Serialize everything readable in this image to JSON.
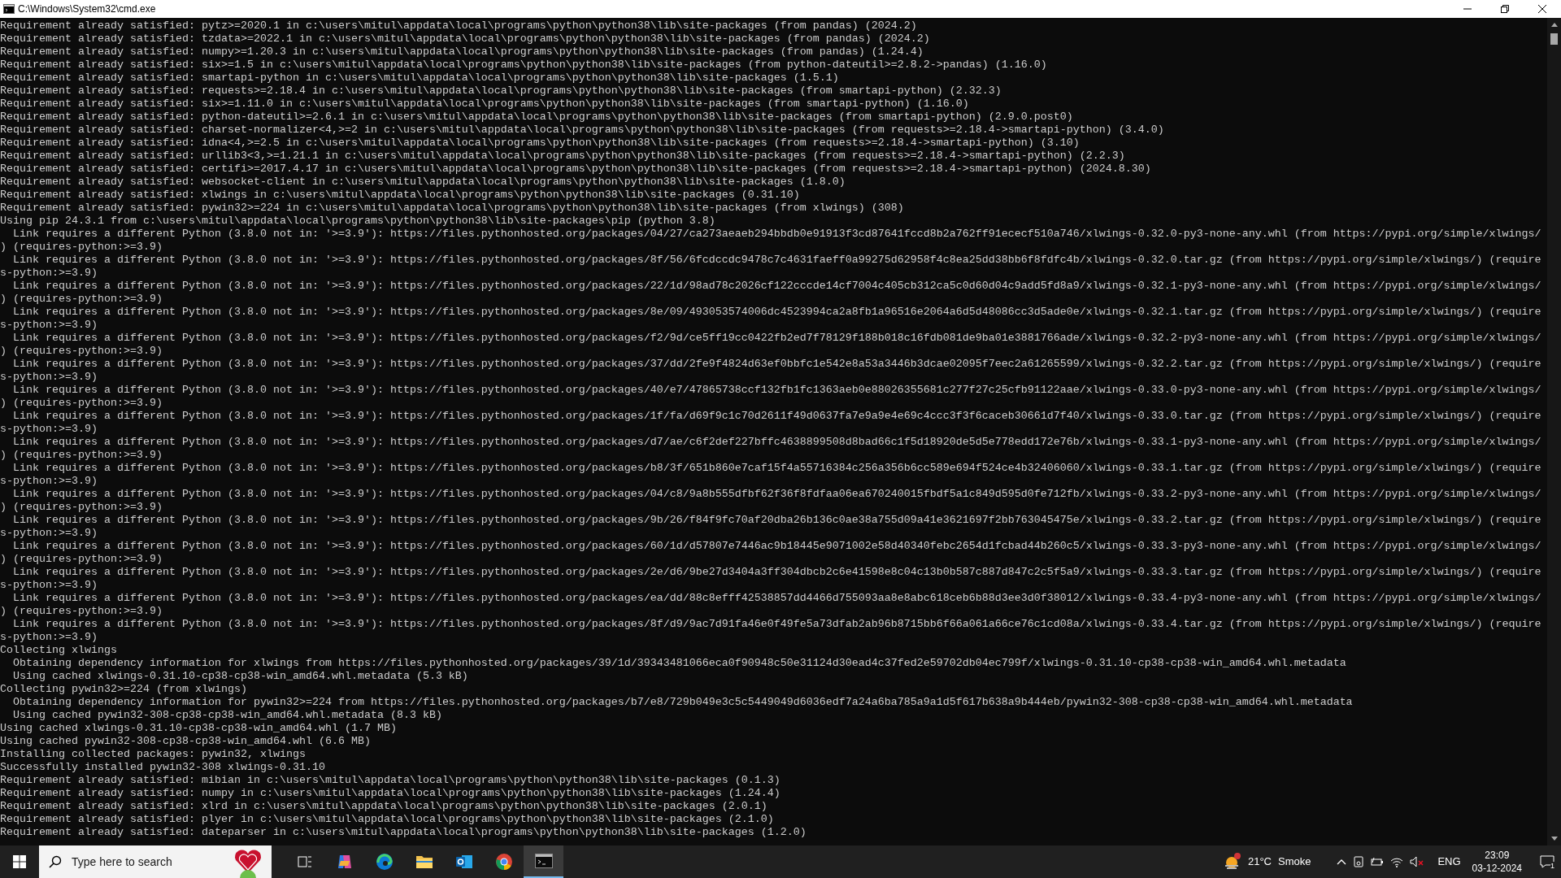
{
  "window": {
    "title": "C:\\Windows\\System32\\cmd.exe"
  },
  "console": {
    "lines": [
      "Requirement already satisfied: pytz>=2020.1 in c:\\users\\mitul\\appdata\\local\\programs\\python\\python38\\lib\\site-packages (from pandas) (2024.2)",
      "Requirement already satisfied: tzdata>=2022.1 in c:\\users\\mitul\\appdata\\local\\programs\\python\\python38\\lib\\site-packages (from pandas) (2024.2)",
      "Requirement already satisfied: numpy>=1.20.3 in c:\\users\\mitul\\appdata\\local\\programs\\python\\python38\\lib\\site-packages (from pandas) (1.24.4)",
      "Requirement already satisfied: six>=1.5 in c:\\users\\mitul\\appdata\\local\\programs\\python\\python38\\lib\\site-packages (from python-dateutil>=2.8.2->pandas) (1.16.0)",
      "Requirement already satisfied: smartapi-python in c:\\users\\mitul\\appdata\\local\\programs\\python\\python38\\lib\\site-packages (1.5.1)",
      "Requirement already satisfied: requests>=2.18.4 in c:\\users\\mitul\\appdata\\local\\programs\\python\\python38\\lib\\site-packages (from smartapi-python) (2.32.3)",
      "Requirement already satisfied: six>=1.11.0 in c:\\users\\mitul\\appdata\\local\\programs\\python\\python38\\lib\\site-packages (from smartapi-python) (1.16.0)",
      "Requirement already satisfied: python-dateutil>=2.6.1 in c:\\users\\mitul\\appdata\\local\\programs\\python\\python38\\lib\\site-packages (from smartapi-python) (2.9.0.post0)",
      "Requirement already satisfied: charset-normalizer<4,>=2 in c:\\users\\mitul\\appdata\\local\\programs\\python\\python38\\lib\\site-packages (from requests>=2.18.4->smartapi-python) (3.4.0)",
      "Requirement already satisfied: idna<4,>=2.5 in c:\\users\\mitul\\appdata\\local\\programs\\python\\python38\\lib\\site-packages (from requests>=2.18.4->smartapi-python) (3.10)",
      "Requirement already satisfied: urllib3<3,>=1.21.1 in c:\\users\\mitul\\appdata\\local\\programs\\python\\python38\\lib\\site-packages (from requests>=2.18.4->smartapi-python) (2.2.3)",
      "Requirement already satisfied: certifi>=2017.4.17 in c:\\users\\mitul\\appdata\\local\\programs\\python\\python38\\lib\\site-packages (from requests>=2.18.4->smartapi-python) (2024.8.30)",
      "Requirement already satisfied: websocket-client in c:\\users\\mitul\\appdata\\local\\programs\\python\\python38\\lib\\site-packages (1.8.0)",
      "Requirement already satisfied: xlwings in c:\\users\\mitul\\appdata\\local\\programs\\python\\python38\\lib\\site-packages (0.31.10)",
      "Requirement already satisfied: pywin32>=224 in c:\\users\\mitul\\appdata\\local\\programs\\python\\python38\\lib\\site-packages (from xlwings) (308)",
      "Using pip 24.3.1 from c:\\users\\mitul\\appdata\\local\\programs\\python\\python38\\lib\\site-packages\\pip (python 3.8)",
      "  Link requires a different Python (3.8.0 not in: '>=3.9'): https://files.pythonhosted.org/packages/04/27/ca273aeaeb294bbdb0e91913f3cd87641fccd8b2a762ff91ececf510a746/xlwings-0.32.0-py3-none-any.whl (from https://pypi.org/simple/xlwings/",
      ") (requires-python:>=3.9)",
      "  Link requires a different Python (3.8.0 not in: '>=3.9'): https://files.pythonhosted.org/packages/8f/56/6fcdccdc9478c7c4631faeff0a99275d62958f4c8ea25dd38bb6f8fdfc4b/xlwings-0.32.0.tar.gz (from https://pypi.org/simple/xlwings/) (require",
      "s-python:>=3.9)",
      "  Link requires a different Python (3.8.0 not in: '>=3.9'): https://files.pythonhosted.org/packages/22/1d/98ad78c2026cf122cccde14cf7004c405cb312ca5c0d60d04c9add5fd8a9/xlwings-0.32.1-py3-none-any.whl (from https://pypi.org/simple/xlwings/",
      ") (requires-python:>=3.9)",
      "  Link requires a different Python (3.8.0 not in: '>=3.9'): https://files.pythonhosted.org/packages/8e/09/493053574006dc4523994ca2a8fb1a96516e2064a6d5d48086cc3d5ade0e/xlwings-0.32.1.tar.gz (from https://pypi.org/simple/xlwings/) (require",
      "s-python:>=3.9)",
      "  Link requires a different Python (3.8.0 not in: '>=3.9'): https://files.pythonhosted.org/packages/f2/9d/ce5ff19cc0422fb2ed7f78129f188b018c16fdb081de9ba01e3881766ade/xlwings-0.32.2-py3-none-any.whl (from https://pypi.org/simple/xlwings/",
      ") (requires-python:>=3.9)",
      "  Link requires a different Python (3.8.0 not in: '>=3.9'): https://files.pythonhosted.org/packages/37/dd/2fe9f4824d63ef0bbfc1e542e8a53a3446b3dcae02095f7eec2a61265599/xlwings-0.32.2.tar.gz (from https://pypi.org/simple/xlwings/) (require",
      "s-python:>=3.9)",
      "  Link requires a different Python (3.8.0 not in: '>=3.9'): https://files.pythonhosted.org/packages/40/e7/47865738ccf132fb1fc1363aeb0e88026355681c277f27c25cfb91122aae/xlwings-0.33.0-py3-none-any.whl (from https://pypi.org/simple/xlwings/",
      ") (requires-python:>=3.9)",
      "  Link requires a different Python (3.8.0 not in: '>=3.9'): https://files.pythonhosted.org/packages/1f/fa/d69f9c1c70d2611f49d0637fa7e9a9e4e69c4ccc3f3f6caceb30661d7f40/xlwings-0.33.0.tar.gz (from https://pypi.org/simple/xlwings/) (require",
      "s-python:>=3.9)",
      "  Link requires a different Python (3.8.0 not in: '>=3.9'): https://files.pythonhosted.org/packages/d7/ae/c6f2def227bffc4638899508d8bad66c1f5d18920de5d5e778edd172e76b/xlwings-0.33.1-py3-none-any.whl (from https://pypi.org/simple/xlwings/",
      ") (requires-python:>=3.9)",
      "  Link requires a different Python (3.8.0 not in: '>=3.9'): https://files.pythonhosted.org/packages/b8/3f/651b860e7caf15f4a55716384c256a356b6cc589e694f524ce4b32406060/xlwings-0.33.1.tar.gz (from https://pypi.org/simple/xlwings/) (require",
      "s-python:>=3.9)",
      "  Link requires a different Python (3.8.0 not in: '>=3.9'): https://files.pythonhosted.org/packages/04/c8/9a8b555dfbf62f36f8fdfaa06ea670240015fbdf5a1c849d595d0fe712fb/xlwings-0.33.2-py3-none-any.whl (from https://pypi.org/simple/xlwings/",
      ") (requires-python:>=3.9)",
      "  Link requires a different Python (3.8.0 not in: '>=3.9'): https://files.pythonhosted.org/packages/9b/26/f84f9fc70af20dba26b136c0ae38a755d09a41e3621697f2bb763045475e/xlwings-0.33.2.tar.gz (from https://pypi.org/simple/xlwings/) (require",
      "s-python:>=3.9)",
      "  Link requires a different Python (3.8.0 not in: '>=3.9'): https://files.pythonhosted.org/packages/60/1d/d57807e7446ac9b18445e9071002e58d40340febc2654d1fcbad44b260c5/xlwings-0.33.3-py3-none-any.whl (from https://pypi.org/simple/xlwings/",
      ") (requires-python:>=3.9)",
      "  Link requires a different Python (3.8.0 not in: '>=3.9'): https://files.pythonhosted.org/packages/2e/d6/9be27d3404a3ff304dbcb2c6e41598e8c04c13b0b587c887d847c2c5f5a9/xlwings-0.33.3.tar.gz (from https://pypi.org/simple/xlwings/) (require",
      "s-python:>=3.9)",
      "  Link requires a different Python (3.8.0 not in: '>=3.9'): https://files.pythonhosted.org/packages/ea/dd/88c8efff42538857dd4466d755093aa8e8abc618ceb6b88d3ee3d0f38012/xlwings-0.33.4-py3-none-any.whl (from https://pypi.org/simple/xlwings/",
      ") (requires-python:>=3.9)",
      "  Link requires a different Python (3.8.0 not in: '>=3.9'): https://files.pythonhosted.org/packages/8f/d9/9ac7d91fa46e0f49fe5a73dfab2ab96b8715bb6f66a061a66ce76c1cd08a/xlwings-0.33.4.tar.gz (from https://pypi.org/simple/xlwings/) (require",
      "s-python:>=3.9)",
      "Collecting xlwings",
      "  Obtaining dependency information for xlwings from https://files.pythonhosted.org/packages/39/1d/39343481066eca0f90948c50e31124d30ead4c37fed2e59702db04ec799f/xlwings-0.31.10-cp38-cp38-win_amd64.whl.metadata",
      "  Using cached xlwings-0.31.10-cp38-cp38-win_amd64.whl.metadata (5.3 kB)",
      "Collecting pywin32>=224 (from xlwings)",
      "  Obtaining dependency information for pywin32>=224 from https://files.pythonhosted.org/packages/b7/e8/729b049e3c5c5449049d6036edf7a24a6ba785a9a1d5f617b638a9b444eb/pywin32-308-cp38-cp38-win_amd64.whl.metadata",
      "  Using cached pywin32-308-cp38-cp38-win_amd64.whl.metadata (8.3 kB)",
      "Using cached xlwings-0.31.10-cp38-cp38-win_amd64.whl (1.7 MB)",
      "Using cached pywin32-308-cp38-cp38-win_amd64.whl (6.6 MB)",
      "Installing collected packages: pywin32, xlwings",
      "Successfully installed pywin32-308 xlwings-0.31.10",
      "Requirement already satisfied: mibian in c:\\users\\mitul\\appdata\\local\\programs\\python\\python38\\lib\\site-packages (0.1.3)",
      "Requirement already satisfied: numpy in c:\\users\\mitul\\appdata\\local\\programs\\python\\python38\\lib\\site-packages (1.24.4)",
      "Requirement already satisfied: xlrd in c:\\users\\mitul\\appdata\\local\\programs\\python\\python38\\lib\\site-packages (2.0.1)",
      "Requirement already satisfied: plyer in c:\\users\\mitul\\appdata\\local\\programs\\python\\python38\\lib\\site-packages (2.1.0)",
      "Requirement already satisfied: dateparser in c:\\users\\mitul\\appdata\\local\\programs\\python\\python38\\lib\\site-packages (1.2.0)"
    ]
  },
  "taskbar": {
    "search": {
      "placeholder": "Type here to search"
    },
    "apps": [
      {
        "kind": "taskview",
        "selected": false
      },
      {
        "kind": "copilot",
        "selected": false
      },
      {
        "kind": "edge",
        "selected": false
      },
      {
        "kind": "explorer",
        "selected": false
      },
      {
        "kind": "outlook",
        "selected": false
      },
      {
        "kind": "chrome",
        "selected": false
      },
      {
        "kind": "terminal",
        "selected": true
      }
    ],
    "weather": {
      "temperature": "21°C",
      "condition": "Smoke"
    },
    "language": "ENG",
    "time": "23:09",
    "date": "03-12-2024",
    "notification_count": "1"
  }
}
